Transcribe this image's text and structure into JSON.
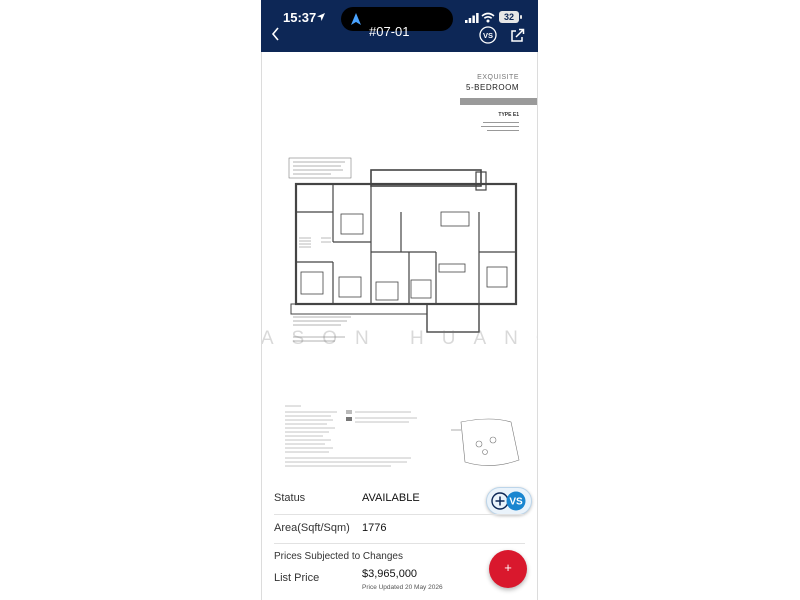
{
  "status_bar": {
    "time": "15:37",
    "battery": "32"
  },
  "nav": {
    "unit_title": "#07-01"
  },
  "floorplan": {
    "heading_line1": "EXQUISITE",
    "heading_line2": "5-BEDROOM",
    "type": "TYPE E1",
    "watermark": "JASON HUANG"
  },
  "info": {
    "status_label": "Status",
    "status_value": "AVAILABLE",
    "area_label": "Area(Sqft/Sqm)",
    "area_value": "1776",
    "prices_note": "Prices Subjected to Changes",
    "list_price_label": "List Price",
    "list_price_value": "$3,965,000",
    "price_updated": "Price Updated 20 May 2026"
  },
  "fab": {
    "label": "+"
  },
  "colors": {
    "nav_bg": "#0d2756",
    "fab_red": "#d9182d",
    "vs_blue": "#1a86d0"
  },
  "icons": [
    "location-arrow-icon",
    "navigation-icon",
    "signal-icon",
    "wifi-icon",
    "battery-icon",
    "back-chevron-icon",
    "vs-logo-icon",
    "share-icon",
    "plus-icon"
  ]
}
